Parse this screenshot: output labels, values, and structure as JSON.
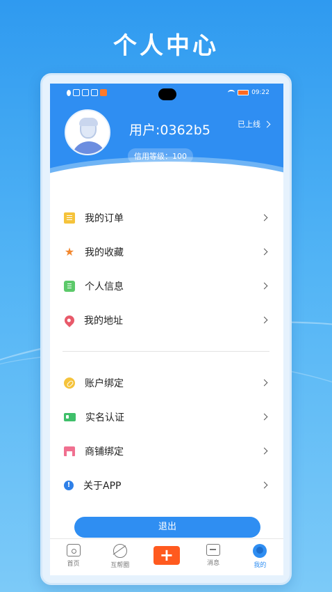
{
  "headline": "个人中心",
  "status_bar": {
    "time": "09:22"
  },
  "profile": {
    "username": "用户:0362b5",
    "credit": "信用等级：100",
    "online_status": "已上线"
  },
  "menu_group1": [
    {
      "label": "我的订单",
      "icon": "clipboard-icon"
    },
    {
      "label": "我的收藏",
      "icon": "star-icon"
    },
    {
      "label": "个人信息",
      "icon": "contact-book-icon"
    },
    {
      "label": "我的地址",
      "icon": "location-pin-icon"
    }
  ],
  "menu_group2": [
    {
      "label": "账户绑定",
      "icon": "link-icon"
    },
    {
      "label": "实名认证",
      "icon": "id-card-icon"
    },
    {
      "label": "商铺绑定",
      "icon": "shop-icon"
    },
    {
      "label": "关于APP",
      "icon": "info-icon"
    }
  ],
  "logout_label": "退出",
  "tabbar": {
    "tabs": [
      {
        "label": "首页",
        "icon": "home-icon"
      },
      {
        "label": "互帮圈",
        "icon": "planet-icon"
      },
      {
        "label": "",
        "icon": "plus-icon"
      },
      {
        "label": "消息",
        "icon": "message-icon"
      },
      {
        "label": "我的",
        "icon": "user-icon",
        "active": true
      }
    ]
  },
  "colors": {
    "primary": "#2f8ef2",
    "accent_orange": "#ff5a1f"
  }
}
